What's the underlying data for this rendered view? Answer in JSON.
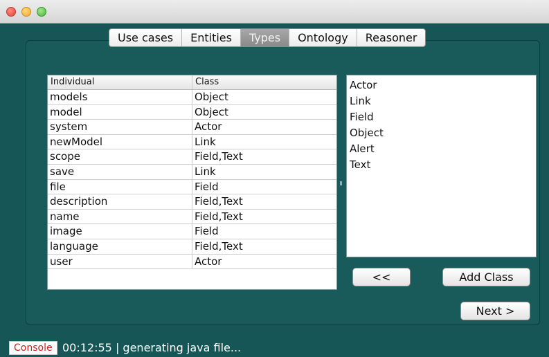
{
  "tabs": [
    "Use cases",
    "Entities",
    "Types",
    "Ontology",
    "Reasoner"
  ],
  "active_tab": "Types",
  "table": {
    "headers": [
      "Individual",
      "Class"
    ],
    "rows": [
      [
        "models",
        "Object"
      ],
      [
        "model",
        "Object"
      ],
      [
        "system",
        "Actor"
      ],
      [
        "newModel",
        "Link"
      ],
      [
        "scope",
        "Field,Text"
      ],
      [
        "save",
        "Link"
      ],
      [
        "file",
        "Field"
      ],
      [
        "description",
        "Field,Text"
      ],
      [
        "name",
        "Field,Text"
      ],
      [
        "image",
        "Field"
      ],
      [
        "language",
        "Field,Text"
      ],
      [
        "user",
        "Actor"
      ]
    ]
  },
  "class_list": [
    "Actor",
    "Link",
    "Field",
    "Object",
    "Alert",
    "Text"
  ],
  "buttons": {
    "back": "<<",
    "add_class": "Add Class",
    "next": "Next >"
  },
  "status": {
    "console_label": "Console",
    "text": "00:12:55 | generating java file..."
  },
  "colors": {
    "window_bg": "#175656",
    "console_label": "#d0201a"
  }
}
